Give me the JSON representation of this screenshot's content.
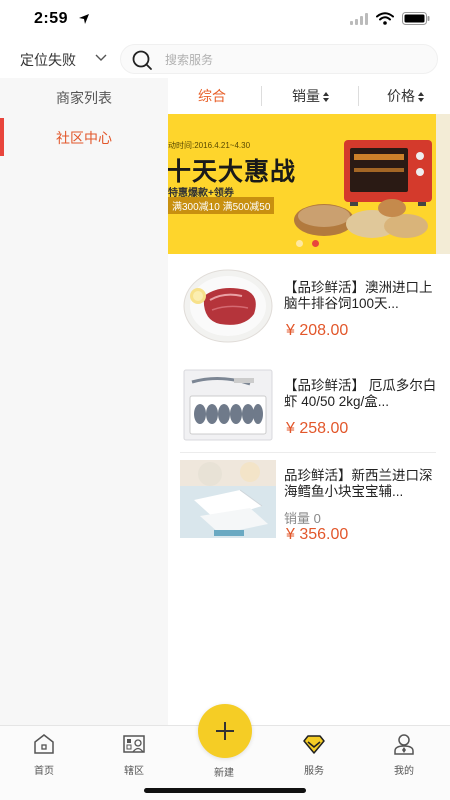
{
  "status": {
    "time": "2:59"
  },
  "header": {
    "location": "定位失败",
    "search_placeholder": "搜索服务"
  },
  "sidebar": {
    "items": [
      {
        "label": "商家列表",
        "active": false
      },
      {
        "label": "社区中心",
        "active": true
      }
    ]
  },
  "sort_tabs": [
    {
      "label": "综合",
      "active": true
    },
    {
      "label": "销量",
      "active": false
    },
    {
      "label": "价格",
      "active": false
    }
  ],
  "banner": {
    "time_text": "动时间:2016.4.21~4.30",
    "title": "十天大惠战",
    "subtitle": "特惠爆款+领券",
    "coupon": "满300减10 满500减50",
    "slide_count": 2,
    "active_slide": 2
  },
  "products": [
    {
      "title": "【品珍鲜活】澳洲进口上脑牛排谷饲100天...",
      "sales": "",
      "price": "¥ 208.00"
    },
    {
      "title": "【品珍鲜活】 厄瓜多尔白虾 40/50 2kg/盒...",
      "sales": "",
      "price": "¥ 258.00"
    },
    {
      "title": "品珍鲜活】新西兰进口深海鳕鱼小块宝宝辅...",
      "sales": "销量 0",
      "price": "¥ 356.00"
    }
  ],
  "tabbar": {
    "items": [
      {
        "label": "首页",
        "icon": "home-icon",
        "active": false
      },
      {
        "label": "辖区",
        "icon": "district-icon",
        "active": false
      },
      {
        "label": "新建",
        "icon": "plus-icon",
        "active": false
      },
      {
        "label": "服务",
        "icon": "diamond-icon",
        "active": true
      },
      {
        "label": "我的",
        "icon": "user-icon",
        "active": false
      }
    ]
  },
  "colors": {
    "accent": "#e2572b",
    "banner_bg": "#fed52c",
    "fab": "#f5cd25",
    "sidebar_indicator": "#e8453c"
  }
}
